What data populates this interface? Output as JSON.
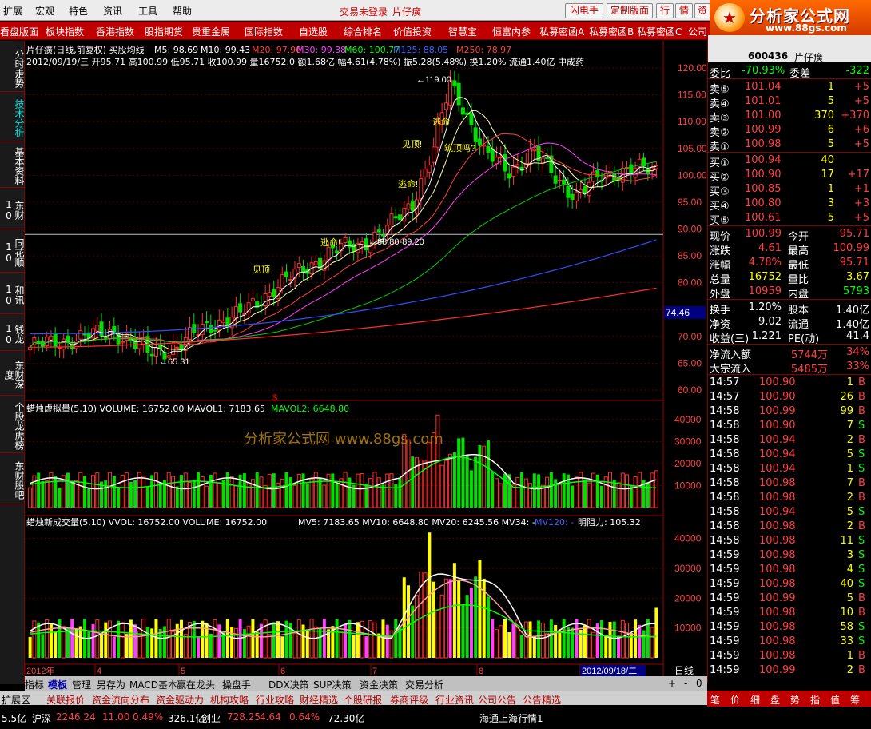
{
  "menu": {
    "items": [
      "扩展",
      "宏观",
      "特色",
      "资讯",
      "工具",
      "帮助"
    ],
    "trade_status": "交易未登录",
    "stock_title": "片仔癀",
    "buttons": [
      "闪电手",
      "定制版面",
      "行",
      "情",
      "资"
    ]
  },
  "logo": {
    "title": "分析家公式网",
    "url": "www.88gs.com"
  },
  "toolbar": {
    "items": [
      "看盘版面",
      "板块指数",
      "香港指数",
      "股指期货",
      "贵重金属",
      "国际指数",
      "自选股",
      "综合排名",
      "价值投资",
      "智慧宝",
      "恒富内参",
      "私募密函A",
      "私募密函B",
      "私募密函C",
      "公司"
    ]
  },
  "left_tabs": [
    "分时走势",
    "技术分析",
    "基本资料",
    "东财10",
    "同花顺10",
    "和讯10",
    "钱龙10",
    "东财深度",
    "个股龙虎榜",
    "东财股吧"
  ],
  "chart": {
    "title_line1": "片仔癀(日线,前复权) 买股均线",
    "ma_labels": [
      {
        "t": "M5: 98.69",
        "c": "#ffffff"
      },
      {
        "t": "M10: 99.43",
        "c": "#ffffff"
      },
      {
        "t": "M20: 97.90",
        "c": "#ff4040"
      },
      {
        "t": "M30: 99.38",
        "c": "#ff40ff"
      },
      {
        "t": "M60: 100.77",
        "c": "#00ff00"
      },
      {
        "t": "M125: 88.05",
        "c": "#4060ff"
      },
      {
        "t": "M250: 78.97",
        "c": "#ff4040"
      }
    ],
    "info_line": "2012/09/19/三 开95.71 高100.99 低95.71 收100.99 量16752.0 额1.68亿 幅4.61(4.78%) 振5.28(5.48%) 换1.20% 流通1.40亿 中成药",
    "annotations": [
      {
        "t": "119.00"
      },
      {
        "t": "65.31"
      },
      {
        "t": "88.80-89.20"
      },
      {
        "t": "74.46"
      },
      {
        "t": "逃命!"
      },
      {
        "t": "见顶!"
      },
      {
        "t": "筑顶吗?"
      },
      {
        "t": "逃命!"
      },
      {
        "t": "见顶"
      },
      {
        "t": "逃命!"
      }
    ],
    "price_axis": [
      "120.00",
      "115.00",
      "110.00",
      "105.00",
      "100.00",
      "95.00",
      "90.00",
      "85.00",
      "80.00",
      "75.00",
      "70.00",
      "65.00",
      "60.00"
    ],
    "vol_title": "蜡烛虚拟量(5,10) VOLUME: 16752.00 MAVOL1: 7183.65",
    "vol_mavol2": "MAVOL2: 6648.80",
    "vol_axis": [
      "40000",
      "30000",
      "20000",
      "10000"
    ],
    "vol2_title": "蜡烛新成交量(5,10) VVOL: 16752.00 VOLUME: 16752.00",
    "vol2_ma": "MV5: 7183.65 MV10: 6648.80 MV20: 6245.56 MV34: -",
    "vol2_mv120": "MV120: -",
    "vol2_resist": "明阻力: 105.32",
    "vol2_axis": [
      "40000",
      "30000",
      "20000",
      "10000"
    ],
    "watermark": "分析家公式网 www.88gs.com",
    "x_labels": [
      "2012年",
      "4",
      "5",
      "6",
      "7",
      "8",
      "2012/09/18/二"
    ],
    "period": "日线"
  },
  "bottom_tabs": [
    "指标",
    "模板",
    "管理",
    "另存为",
    "MACD基本",
    "赢在龙头",
    "操盘手",
    "DDX决策",
    "SUP决策",
    "资金决策",
    "交易分析"
  ],
  "bottom_ctrl": [
    "+",
    "-",
    "0"
  ],
  "func_tabs": [
    "扩展区",
    "关联报价",
    "资金流向分布",
    "资金驱动力",
    "机构攻略",
    "行业攻略",
    "财经精选",
    "个股研报",
    "券商评级",
    "行业资讯",
    "公司公告",
    "公告精选"
  ],
  "quote": {
    "code": "600436",
    "name": "片仔癀",
    "wb": {
      "label": "委比",
      "value": "-70.93%",
      "label2": "委差",
      "value2": "-322"
    },
    "sells": [
      {
        "l": "卖⑤",
        "p": "101.04",
        "v": "1",
        "d": "+5"
      },
      {
        "l": "卖④",
        "p": "101.01",
        "v": "5",
        "d": "+5"
      },
      {
        "l": "卖③",
        "p": "101.00",
        "v": "370",
        "d": "+370"
      },
      {
        "l": "卖②",
        "p": "100.99",
        "v": "6",
        "d": "+6"
      },
      {
        "l": "卖①",
        "p": "100.98",
        "v": "5",
        "d": "+5"
      }
    ],
    "buys": [
      {
        "l": "买①",
        "p": "100.94",
        "v": "40",
        "d": ""
      },
      {
        "l": "买②",
        "p": "100.90",
        "v": "17",
        "d": "+17"
      },
      {
        "l": "买③",
        "p": "100.85",
        "v": "1",
        "d": "+1"
      },
      {
        "l": "买④",
        "p": "100.80",
        "v": "3",
        "d": "+3"
      },
      {
        "l": "买⑤",
        "p": "100.61",
        "v": "5",
        "d": "+5"
      }
    ],
    "stats": [
      {
        "a": "现价",
        "b": "100.99",
        "c": "今开",
        "d": "95.71"
      },
      {
        "a": "涨跌",
        "b": "4.61",
        "c": "最高",
        "d": "100.99"
      },
      {
        "a": "涨幅",
        "b": "4.78%",
        "c": "最低",
        "d": "95.71"
      },
      {
        "a": "总量",
        "b": "16752",
        "c": "量比",
        "d": "3.67"
      },
      {
        "a": "外盘",
        "b": "10959",
        "c": "内盘",
        "d": "5793"
      }
    ],
    "stats2": [
      {
        "a": "换手",
        "b": "1.20%",
        "c": "股本",
        "d": "1.40亿"
      },
      {
        "a": "净资",
        "b": "9.02",
        "c": "流通",
        "d": "1.40亿"
      },
      {
        "a": "收益(三)",
        "b": "1.221",
        "c": "PE(动)",
        "d": "41.4"
      }
    ],
    "flows": [
      {
        "a": "净流入额",
        "b": "5744万",
        "c": "34%"
      },
      {
        "a": "大宗流入",
        "b": "5485万",
        "c": "33%"
      }
    ],
    "ticks": [
      {
        "t": "14:57",
        "p": "100.90",
        "v": "1",
        "s": "B"
      },
      {
        "t": "14:57",
        "p": "100.90",
        "v": "26",
        "s": "B"
      },
      {
        "t": "14:58",
        "p": "100.99",
        "v": "99",
        "s": "B"
      },
      {
        "t": "14:58",
        "p": "100.90",
        "v": "7",
        "s": "S"
      },
      {
        "t": "14:58",
        "p": "100.94",
        "v": "2",
        "s": "B"
      },
      {
        "t": "14:58",
        "p": "100.94",
        "v": "5",
        "s": "S"
      },
      {
        "t": "14:58",
        "p": "100.94",
        "v": "1",
        "s": "S"
      },
      {
        "t": "14:58",
        "p": "100.98",
        "v": "7",
        "s": "B"
      },
      {
        "t": "14:58",
        "p": "100.98",
        "v": "2",
        "s": "B"
      },
      {
        "t": "14:58",
        "p": "100.94",
        "v": "5",
        "s": "S"
      },
      {
        "t": "14:58",
        "p": "100.98",
        "v": "2",
        "s": "B"
      },
      {
        "t": "14:58",
        "p": "100.98",
        "v": "11",
        "s": "S"
      },
      {
        "t": "14:59",
        "p": "100.98",
        "v": "3",
        "s": "S"
      },
      {
        "t": "14:59",
        "p": "100.98",
        "v": "4",
        "s": "S"
      },
      {
        "t": "14:59",
        "p": "100.98",
        "v": "40",
        "s": "S"
      },
      {
        "t": "14:59",
        "p": "100.99",
        "v": "5",
        "s": "B"
      },
      {
        "t": "14:59",
        "p": "100.98",
        "v": "10",
        "s": "B"
      },
      {
        "t": "14:59",
        "p": "100.98",
        "v": "58",
        "s": "S"
      },
      {
        "t": "14:59",
        "p": "100.98",
        "v": "33",
        "s": "S"
      },
      {
        "t": "14:59",
        "p": "100.98",
        "v": "1",
        "s": "B"
      },
      {
        "t": "14:59",
        "p": "100.99",
        "v": "2",
        "s": "B"
      }
    ],
    "tabs": [
      "笔",
      "价",
      "细",
      "盘",
      "势",
      "指",
      "值",
      "筹"
    ]
  },
  "status": {
    "items": [
      {
        "t": "5.5亿",
        "c": "#ffffff"
      },
      {
        "t": "沪深",
        "c": "#ffffff"
      },
      {
        "t": "2246.24",
        "c": "#ff4040"
      },
      {
        "t": "11.00",
        "c": "#ff4040"
      },
      {
        "t": "0.49%",
        "c": "#ff4040"
      },
      {
        "t": "326.1亿",
        "c": "#ffffff"
      },
      {
        "t": "创业",
        "c": "#ffffff"
      },
      {
        "t": "728.25",
        "c": "#ff4040"
      },
      {
        "t": "4.64",
        "c": "#ff4040"
      },
      {
        "t": "0.64%",
        "c": "#ff4040"
      },
      {
        "t": "72.30亿",
        "c": "#ffffff"
      },
      {
        "t": "海通上海行情1",
        "c": "#ffffff"
      }
    ]
  }
}
